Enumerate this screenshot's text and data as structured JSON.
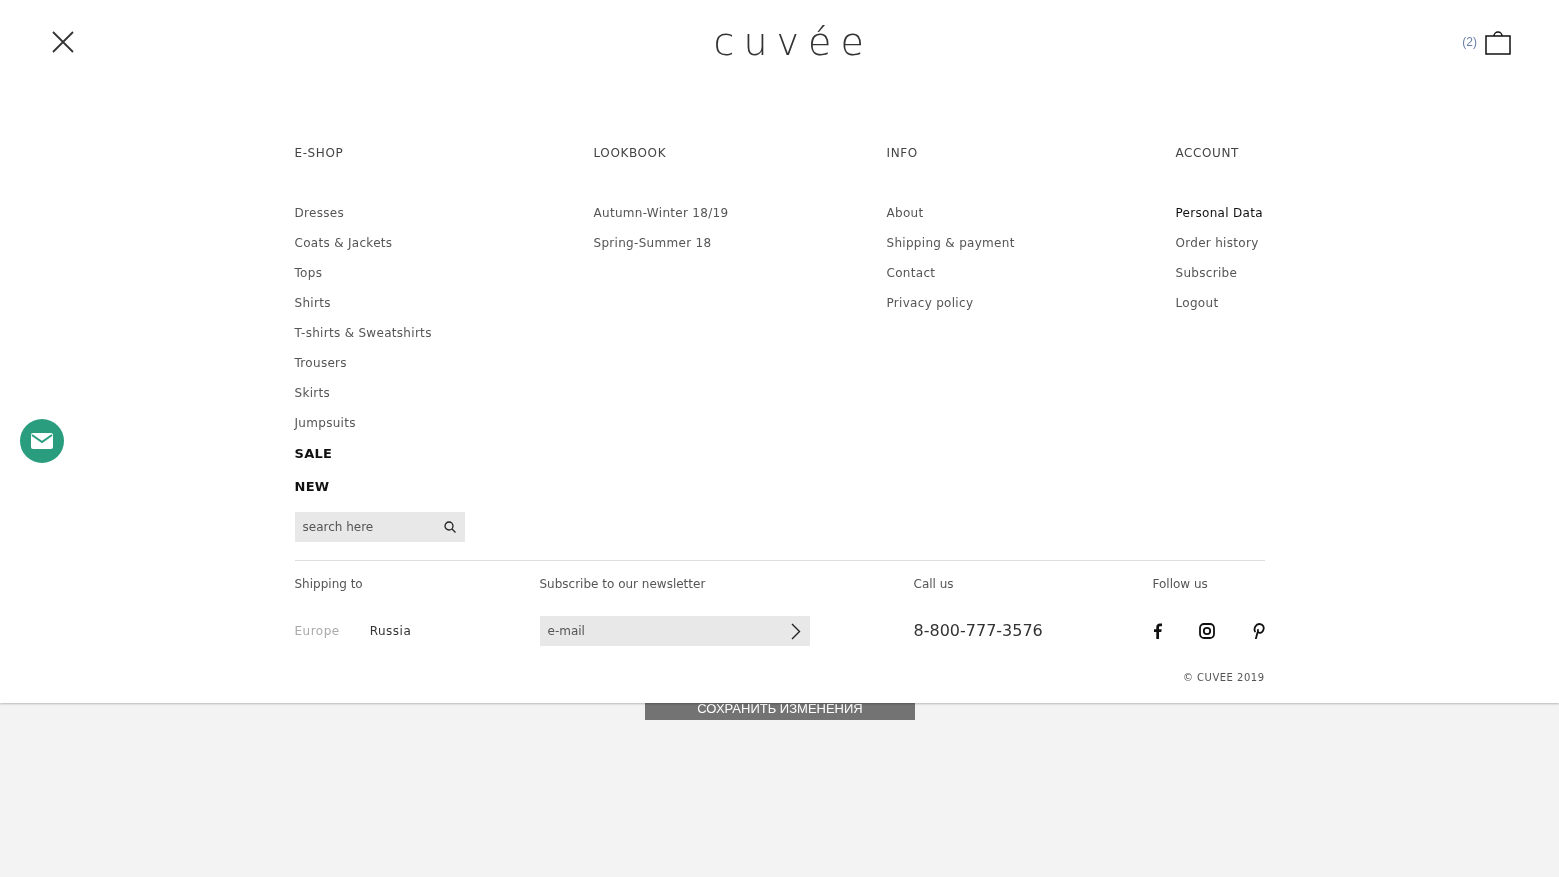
{
  "header": {
    "logo": "cuvée",
    "cart_count": "(2)"
  },
  "menu": [
    {
      "title": "E-SHOP",
      "items": [
        {
          "label": "Dresses",
          "kind": "link",
          "selected": false
        },
        {
          "label": "Coats & Jackets",
          "kind": "link",
          "selected": false
        },
        {
          "label": "Tops",
          "kind": "link",
          "selected": false
        },
        {
          "label": "Shirts",
          "kind": "link",
          "selected": false
        },
        {
          "label": "T-shirts & Sweatshirts",
          "kind": "link",
          "selected": false
        },
        {
          "label": "Trousers",
          "kind": "link",
          "selected": false
        },
        {
          "label": "Skirts",
          "kind": "link",
          "selected": false
        },
        {
          "label": "Jumpsuits",
          "kind": "link",
          "selected": false
        },
        {
          "label": "SALE",
          "kind": "featured"
        },
        {
          "label": "NEW",
          "kind": "featured"
        }
      ],
      "search": {
        "placeholder": "search here"
      }
    },
    {
      "title": "LOOKBOOK",
      "items": [
        {
          "label": "Autumn-Winter 18/19",
          "kind": "link",
          "selected": false
        },
        {
          "label": "Spring-Summer 18",
          "kind": "link",
          "selected": false
        }
      ]
    },
    {
      "title": "INFO",
      "items": [
        {
          "label": "About",
          "kind": "link",
          "selected": false
        },
        {
          "label": "Shipping & payment",
          "kind": "link",
          "selected": false
        },
        {
          "label": "Contact",
          "kind": "link",
          "selected": false
        },
        {
          "label": "Privacy policy",
          "kind": "link",
          "selected": false
        }
      ]
    },
    {
      "title": "ACCOUNT",
      "items": [
        {
          "label": "Personal Data",
          "kind": "link",
          "selected": true
        },
        {
          "label": "Order history",
          "kind": "link",
          "selected": false
        },
        {
          "label": "Subscribe",
          "kind": "link",
          "selected": false
        },
        {
          "label": "Logout",
          "kind": "link",
          "selected": false
        }
      ]
    }
  ],
  "footer": {
    "shipping": {
      "label": "Shipping to",
      "options": [
        {
          "label": "Europe",
          "selected": false
        },
        {
          "label": "Russia",
          "selected": true
        }
      ]
    },
    "newsletter": {
      "label": "Subscribe to our newsletter",
      "placeholder": "e-mail"
    },
    "call": {
      "label": "Call us",
      "phone": "8-800-777-3576"
    },
    "follow": {
      "label": "Follow us",
      "networks": [
        {
          "kind": "facebook"
        },
        {
          "kind": "instagram"
        },
        {
          "kind": "pinterest"
        }
      ]
    },
    "copyright": "© CUVEE 2019"
  },
  "behind": {
    "save_button": "СОХРАНИТЬ ИЗМЕНЕНИЯ"
  }
}
